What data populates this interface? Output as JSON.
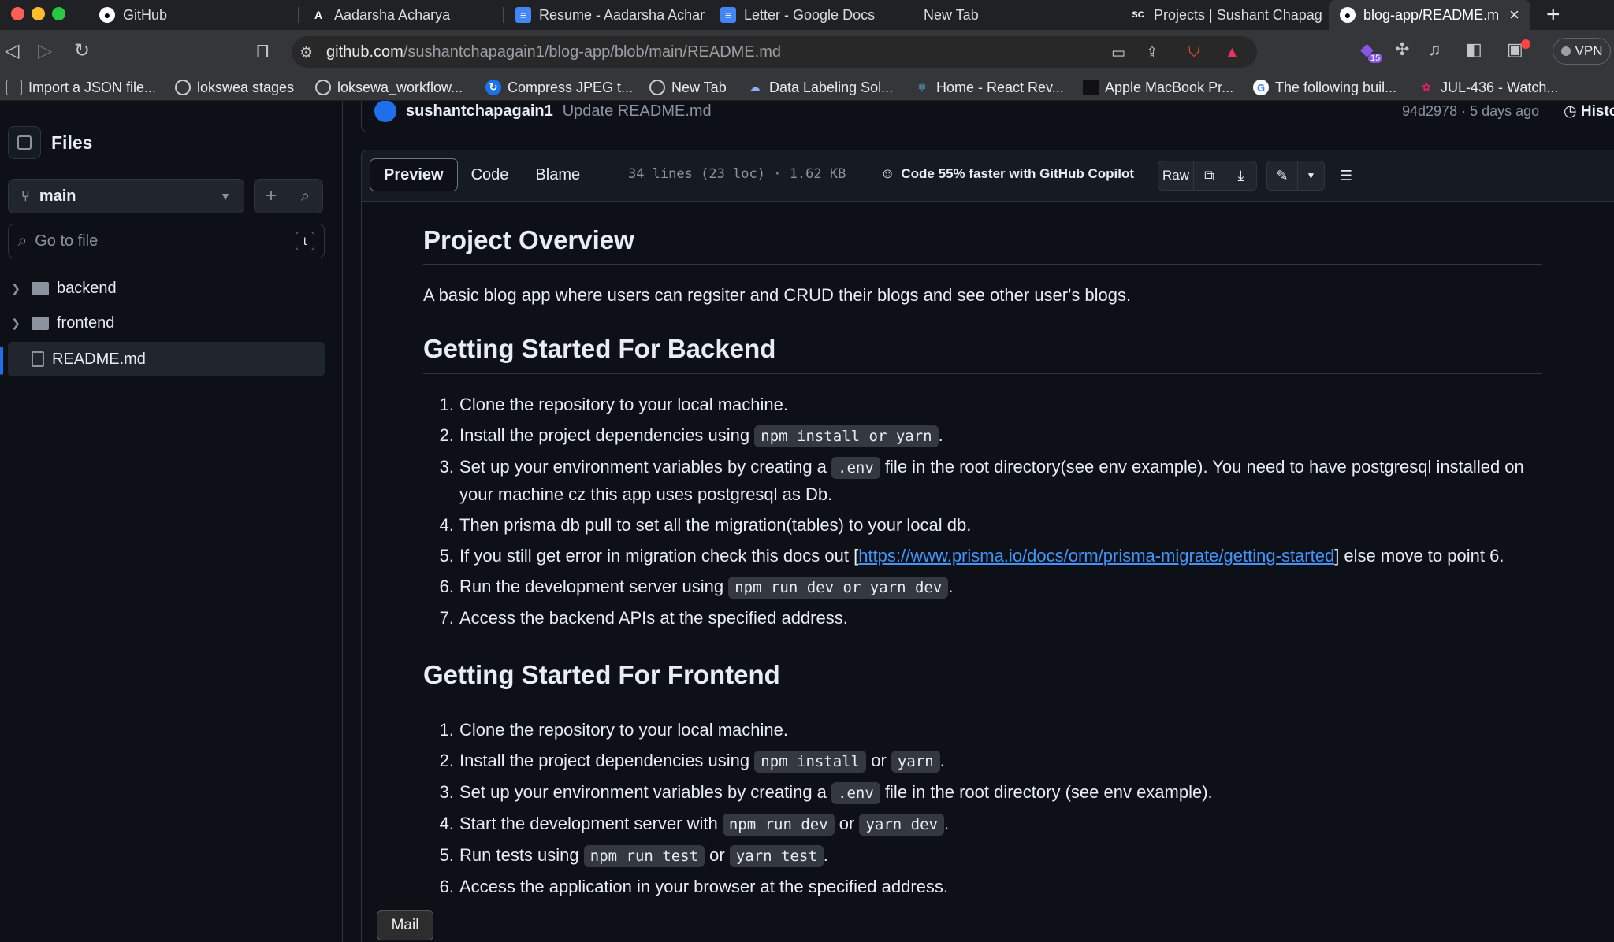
{
  "tabs": [
    {
      "title": "GitHub",
      "icon": "github-icon"
    },
    {
      "title": "Aadarsha Acharya",
      "icon": "a-logo-icon"
    },
    {
      "title": "Resume - Aadarsha Achar",
      "icon": "google-docs-icon"
    },
    {
      "title": "Letter - Google Docs",
      "icon": "google-docs-icon"
    },
    {
      "title": "New Tab",
      "icon": ""
    },
    {
      "title": "Projects | Sushant Chapag",
      "icon": "sc-logo-icon"
    },
    {
      "title": "blog-app/README.m",
      "icon": "github-icon",
      "active": true
    }
  ],
  "address": {
    "host": "github.com",
    "path": "/sushantchapagain1/blog-app/blob/main/README.md"
  },
  "extensions": {
    "badge": "15",
    "vpn_label": "VPN"
  },
  "bookmarks": [
    "Import a JSON file...",
    "lokswea stages",
    "loksewa_workflow...",
    "Compress JPEG t...",
    "New Tab",
    "Data Labeling Sol...",
    "Home - React Rev...",
    "Apple MacBook Pr...",
    "The following buil...",
    "JUL-436 - Watch..."
  ],
  "sidebar": {
    "title": "Files",
    "branch": "main",
    "search_placeholder": "Go to file",
    "search_key": "t",
    "tree": [
      {
        "name": "backend",
        "type": "folder"
      },
      {
        "name": "frontend",
        "type": "folder"
      },
      {
        "name": "README.md",
        "type": "file",
        "active": true
      }
    ]
  },
  "commit": {
    "author": "sushantchapagain1",
    "message": "Update README.md",
    "meta": "94d2978 · 5 days ago",
    "history_label": "History"
  },
  "file_header": {
    "tabs": [
      "Preview",
      "Code",
      "Blame"
    ],
    "active_tab": "Preview",
    "meta": "34 lines (23 loc) · 1.62 KB",
    "copilot": "Code 55% faster with GitHub Copilot",
    "raw_label": "Raw"
  },
  "readme": {
    "overview_heading": "Project Overview",
    "overview_text": "A basic blog app where users can regsiter and CRUD their blogs and see other user's blogs.",
    "backend_heading": "Getting Started For Backend",
    "backend": {
      "s1": "Clone the repository to your local machine.",
      "s2_pre": "Install the project dependencies using ",
      "s2_code": "npm install or yarn",
      "s2_post": ".",
      "s3_pre": "Set up your environment variables by creating a ",
      "s3_code": ".env",
      "s3_post": " file in the root directory(see env example). You need to have postgresql installed on your machine cz this app uses postgresql as Db.",
      "s4": "Then prisma db pull to set all the migration(tables) to your local db.",
      "s5_pre": "If you still get error in migration check this docs out [",
      "s5_link": "https://www.prisma.io/docs/orm/prisma-migrate/getting-started",
      "s5_post": "] else move to point 6.",
      "s6_pre": "Run the development server using ",
      "s6_code": "npm run dev or yarn dev",
      "s6_post": ".",
      "s7": "Access the backend APIs at the specified address."
    },
    "frontend_heading": "Getting Started For Frontend",
    "frontend": {
      "s1": "Clone the repository to your local machine.",
      "s2_pre": "Install the project dependencies using ",
      "s2_code1": "npm install",
      "s2_mid": " or ",
      "s2_code2": "yarn",
      "s2_post": ".",
      "s3_pre": "Set up your environment variables by creating a ",
      "s3_code": ".env",
      "s3_post": " file in the root directory (see env example).",
      "s4_pre": "Start the development server with ",
      "s4_code1": "npm run dev",
      "s4_mid": " or ",
      "s4_code2": "yarn dev",
      "s4_post": ".",
      "s5_pre": "Run tests using ",
      "s5_code1": "npm run test",
      "s5_mid": " or ",
      "s5_code2": "yarn test",
      "s5_post": ".",
      "s6": "Access the application in your browser at the specified address."
    },
    "numbers": [
      "1.",
      "2.",
      "3.",
      "4.",
      "5.",
      "6.",
      "7."
    ]
  },
  "tooltip": "Mail"
}
